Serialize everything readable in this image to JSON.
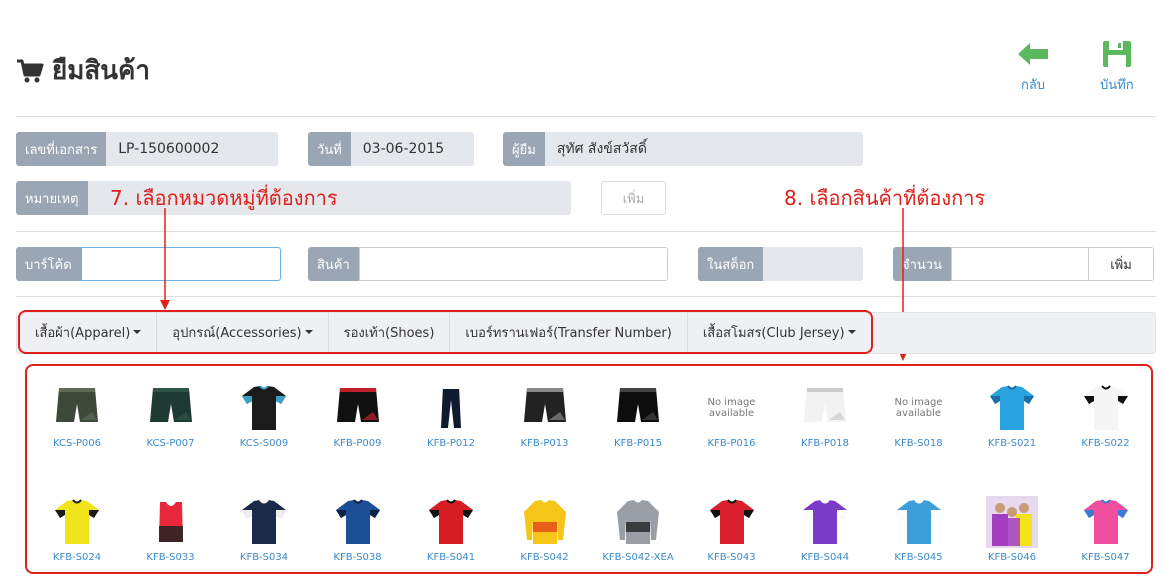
{
  "page": {
    "title": "ยืมสินค้า"
  },
  "actions": {
    "back_label": "กลับ",
    "save_label": "บันทึก"
  },
  "form": {
    "doc_no_label": "เลขที่เอกสาร",
    "doc_no_value": "LP-150600002",
    "date_label": "วันที่",
    "date_value": "03-06-2015",
    "borrower_label": "ผู้ยืม",
    "borrower_value": "สุทัศ สังข์สวัสดิ์",
    "note_label": "หมายเหตุ",
    "note_value": "",
    "note_add_label": "เพิ่ม"
  },
  "item_entry": {
    "barcode_label": "บาร์โค้ด",
    "product_label": "สินค้า",
    "stock_label": "ในสต็อก",
    "qty_label": "จำนวน",
    "add_label": "เพิ่ม"
  },
  "annotations": {
    "step7": "7. เลือกหมวดหมู่ที่ต้องการ",
    "step8": "8. เลือกสินค้าที่ต้องการ"
  },
  "categories": [
    {
      "label": "เสื้อผ้า(Apparel)",
      "dropdown": true
    },
    {
      "label": "อุปกรณ์(Accessories)",
      "dropdown": true
    },
    {
      "label": "รองเท้า(Shoes)",
      "dropdown": false
    },
    {
      "label": "เบอร์ทรานเฟอร์(Transfer Number)",
      "dropdown": false
    },
    {
      "label": "เสื้อสโมสร(Club Jersey)",
      "dropdown": true
    }
  ],
  "no_image_text": [
    "No image",
    "available"
  ],
  "products": [
    {
      "code": "KCS-P006",
      "kind": "shorts",
      "color": "#3d4a3a",
      "accent": "#5e6b55"
    },
    {
      "code": "KCS-P007",
      "kind": "shorts",
      "color": "#1e3a32",
      "accent": "#2f5548"
    },
    {
      "code": "KCS-S009",
      "kind": "shirt",
      "color": "#1b1b1b",
      "accent": "#3aa0c8"
    },
    {
      "code": "KFB-P009",
      "kind": "shorts",
      "color": "#111111",
      "accent": "#c0202a"
    },
    {
      "code": "KFB-P012",
      "kind": "pants",
      "color": "#0f1a2e",
      "accent": "#ffffff"
    },
    {
      "code": "KFB-P013",
      "kind": "shorts",
      "color": "#222222",
      "accent": "#888888"
    },
    {
      "code": "KFB-P015",
      "kind": "shorts",
      "color": "#0d0d0d",
      "accent": "#444444"
    },
    {
      "code": "KFB-P016",
      "kind": "noimage"
    },
    {
      "code": "KFB-P018",
      "kind": "shorts",
      "color": "#f2f2f2",
      "accent": "#cccccc"
    },
    {
      "code": "KFB-S018",
      "kind": "noimage"
    },
    {
      "code": "KFB-S021",
      "kind": "shirt",
      "color": "#29a3e0",
      "accent": "#1a6fa8"
    },
    {
      "code": "KFB-S022",
      "kind": "shirt",
      "color": "#f5f5f5",
      "accent": "#111111"
    },
    {
      "code": "KFB-S024",
      "kind": "shirt",
      "color": "#f2e41c",
      "accent": "#1a1a1a"
    },
    {
      "code": "KFB-S033",
      "kind": "vest",
      "color": "#e8283a",
      "accent": "#222222"
    },
    {
      "code": "KFB-S034",
      "kind": "shirt",
      "color": "#1b2a48",
      "accent": "#f0f0f0"
    },
    {
      "code": "KFB-S038",
      "kind": "shirt",
      "color": "#1c4f96",
      "accent": "#0d2244"
    },
    {
      "code": "KFB-S041",
      "kind": "shirt",
      "color": "#d81c24",
      "accent": "#111111"
    },
    {
      "code": "KFB-S042",
      "kind": "longshirt",
      "color": "#f5c518",
      "accent": "#e23c1a"
    },
    {
      "code": "KFB-S042-XEA",
      "kind": "longshirt",
      "color": "#9a9fa5",
      "accent": "#1a1a1a"
    },
    {
      "code": "KFB-S043",
      "kind": "shirt",
      "color": "#d8202c",
      "accent": "#111111"
    },
    {
      "code": "KFB-S044",
      "kind": "shirt",
      "color": "#7a3bc8",
      "accent": "#ffffff"
    },
    {
      "code": "KFB-S045",
      "kind": "shirt",
      "color": "#3d9fd8",
      "accent": "#ffffff"
    },
    {
      "code": "KFB-S046",
      "kind": "team",
      "color": "#a43ec0",
      "accent": "#f2e41c"
    },
    {
      "code": "KFB-S047",
      "kind": "shirt",
      "color": "#f04ea0",
      "accent": "#3a7bd8"
    }
  ]
}
